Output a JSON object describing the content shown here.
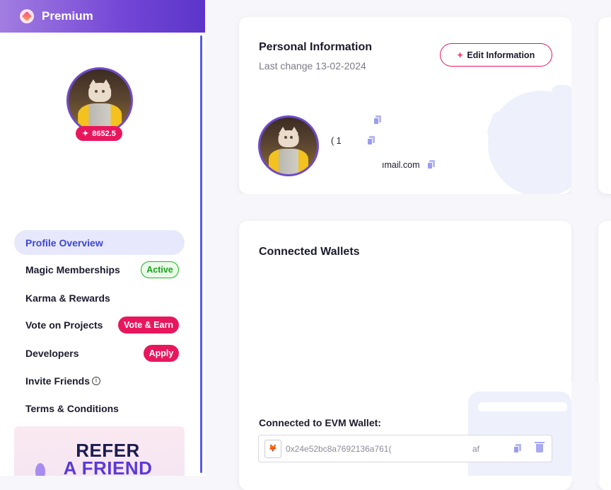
{
  "brand": {
    "title": "Premium"
  },
  "profile": {
    "karma": "8652.5"
  },
  "nav": [
    {
      "label": "Profile Overview",
      "active": true
    },
    {
      "label": "Magic Memberships",
      "badge": "Active"
    },
    {
      "label": "Karma & Rewards"
    },
    {
      "label": "Vote on Projects",
      "badge": "Vote & Earn"
    },
    {
      "label": "Developers",
      "badge": "Apply"
    },
    {
      "label": "Invite Friends"
    },
    {
      "label": "Terms & Conditions"
    }
  ],
  "refer": {
    "line1": "REFER",
    "line2": "A FRIEND"
  },
  "personal": {
    "title": "Personal Information",
    "last_change": "Last change 13-02-2024",
    "edit_button": "Edit Information",
    "field1": "",
    "field2": "(        1",
    "email": "ımail.com"
  },
  "wallets": {
    "title": "Connected Wallets",
    "evm_label": "Connected to EVM Wallet:",
    "address": "0x24e52bc8a7692136a761(",
    "address_end": "af"
  },
  "colors": {
    "accent": "#e8175d",
    "primary": "#5a39d8",
    "active_bg": "#e7e8fb"
  }
}
